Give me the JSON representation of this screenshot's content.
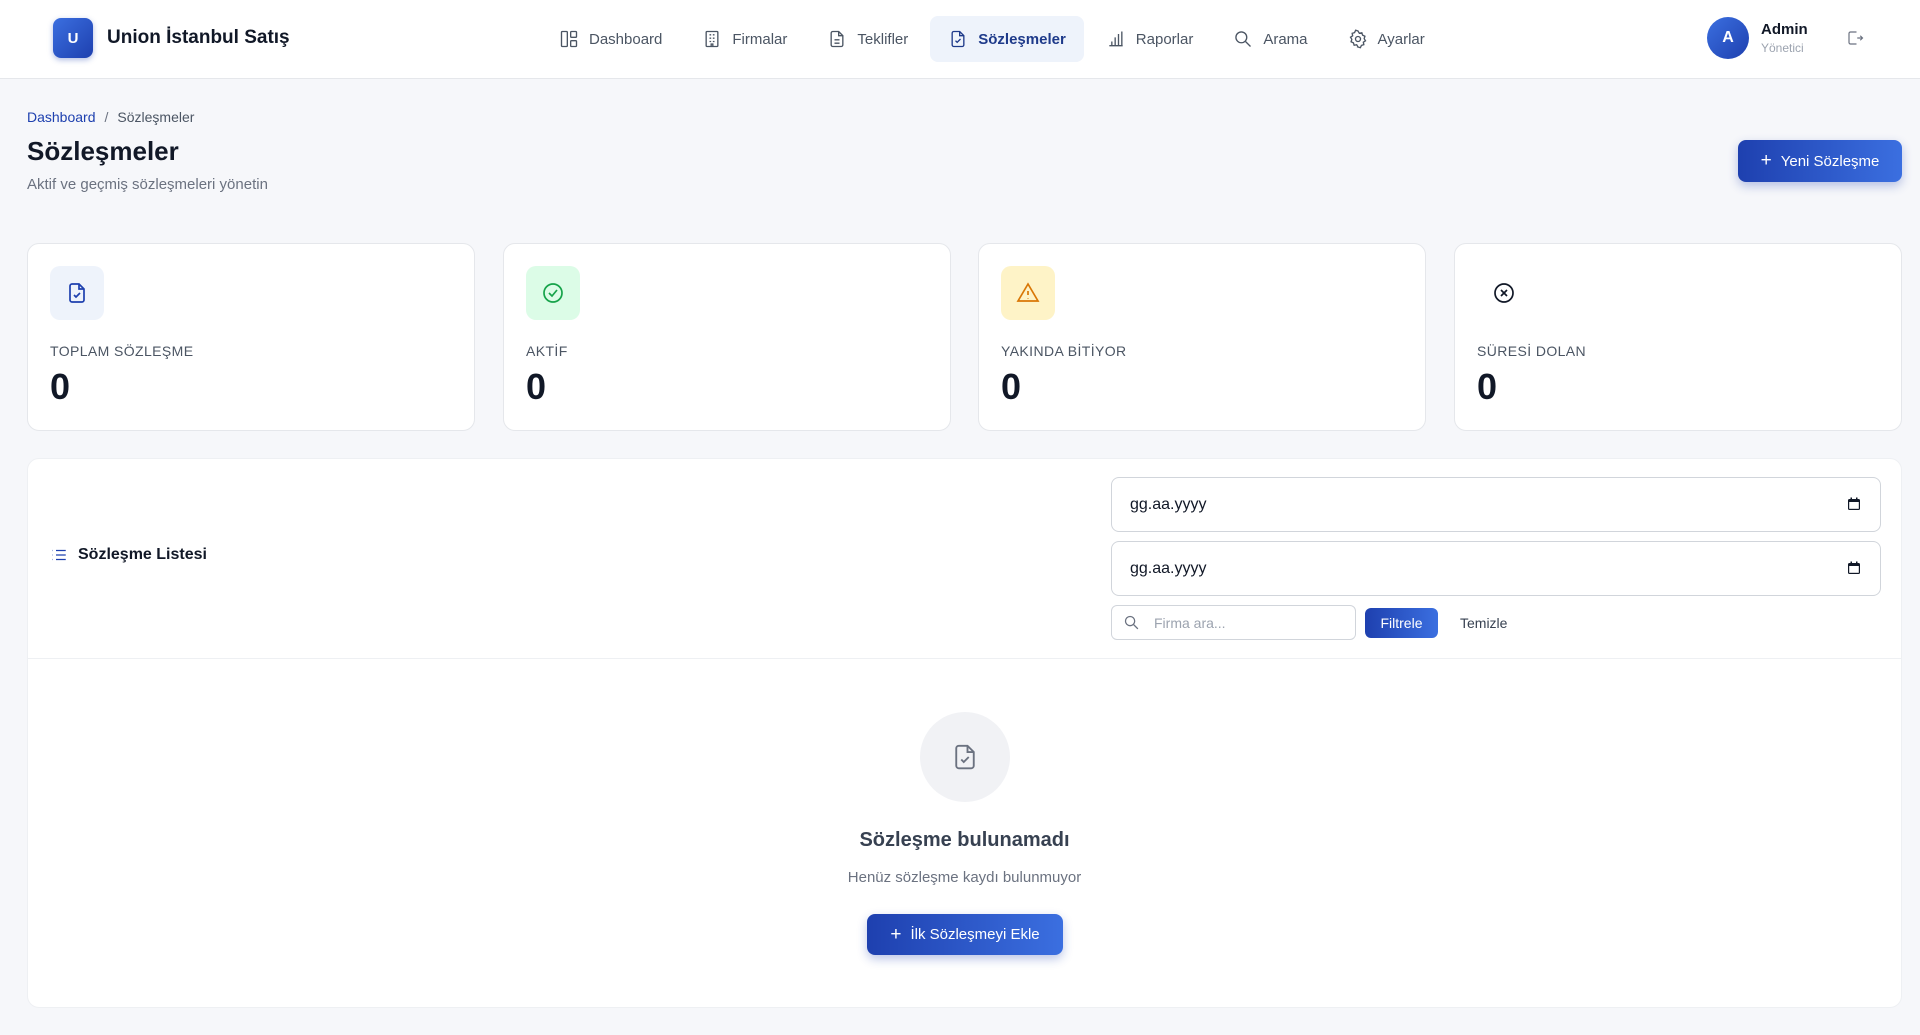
{
  "app": {
    "logo_letter": "U",
    "name": "Union İstanbul Satış"
  },
  "nav": {
    "items": [
      {
        "label": "Dashboard",
        "icon": "dashboard-icon"
      },
      {
        "label": "Firmalar",
        "icon": "building-icon"
      },
      {
        "label": "Teklifler",
        "icon": "document-icon"
      },
      {
        "label": "Sözleşmeler",
        "icon": "contract-icon",
        "active": true
      },
      {
        "label": "Raporlar",
        "icon": "bar-chart-icon"
      },
      {
        "label": "Arama",
        "icon": "search-icon"
      },
      {
        "label": "Ayarlar",
        "icon": "gear-icon"
      }
    ]
  },
  "user": {
    "initial": "A",
    "name": "Admin",
    "role": "Yönetici"
  },
  "breadcrumb": {
    "home": "Dashboard",
    "separator": "/",
    "current": "Sözleşmeler"
  },
  "page": {
    "title": "Sözleşmeler",
    "subtitle": "Aktif ve geçmiş sözleşmeleri yönetin",
    "new_button": "Yeni Sözleşme"
  },
  "stats": [
    {
      "label": "TOPLAM SÖZLEŞME",
      "value": "0",
      "icon": "contract-icon",
      "bg": "#eef3fb",
      "color": "#1e40af"
    },
    {
      "label": "AKTİF",
      "value": "0",
      "icon": "check-circle-icon",
      "bg": "#dcfce7",
      "color": "#16a34a"
    },
    {
      "label": "YAKINDA BİTİYOR",
      "value": "0",
      "icon": "warning-icon",
      "bg": "#fef3c7",
      "color": "#d97706"
    },
    {
      "label": "SÜRESİ DOLAN",
      "value": "0",
      "icon": "x-circle-icon",
      "bg": "#ffffff",
      "color": "#111827"
    }
  ],
  "list": {
    "title": "Sözleşme Listesi",
    "start_date": "gg.aa.yyyy",
    "end_date": "gg.aa.yyyy",
    "search_placeholder": "Firma ara...",
    "filter_button": "Filtrele",
    "clear_button": "Temizle"
  },
  "empty": {
    "title": "Sözleşme bulunamadı",
    "subtitle": "Henüz sözleşme kaydı bulunmuyor",
    "button": "İlk Sözleşmeyi Ekle"
  }
}
